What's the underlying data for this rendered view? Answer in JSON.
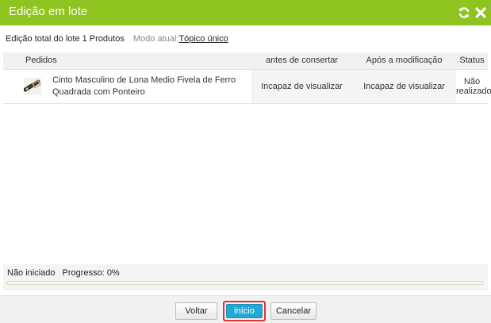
{
  "dialog": {
    "title": "Edição em lote"
  },
  "subheader": {
    "summary": "Edição total do lote 1 Produtos",
    "mode_label": "Modo atual:",
    "mode_value": "Tópico único"
  },
  "table": {
    "columns": {
      "pedidos": "Pedidos",
      "before": "antes de consertar",
      "after": "Após a modificação",
      "status": "Status"
    },
    "rows": [
      {
        "product_name": "Cinto Masculino de Lona Medio Fivela de Ferro Quadrada com Ponteiro",
        "before": "Incapaz de visualizar",
        "after": "Incapaz de visualizar",
        "status": "Não realizado"
      }
    ]
  },
  "progress": {
    "state": "Não iniciado",
    "label": "Progresso:",
    "value_text": "0%",
    "value": 0
  },
  "buttons": {
    "back": "Voltar",
    "start": "início",
    "cancel": "Cancelar"
  },
  "colors": {
    "titlebar": "#8fc31f",
    "primary_button": "#21a9d6",
    "highlight_ring": "#e8322f"
  }
}
